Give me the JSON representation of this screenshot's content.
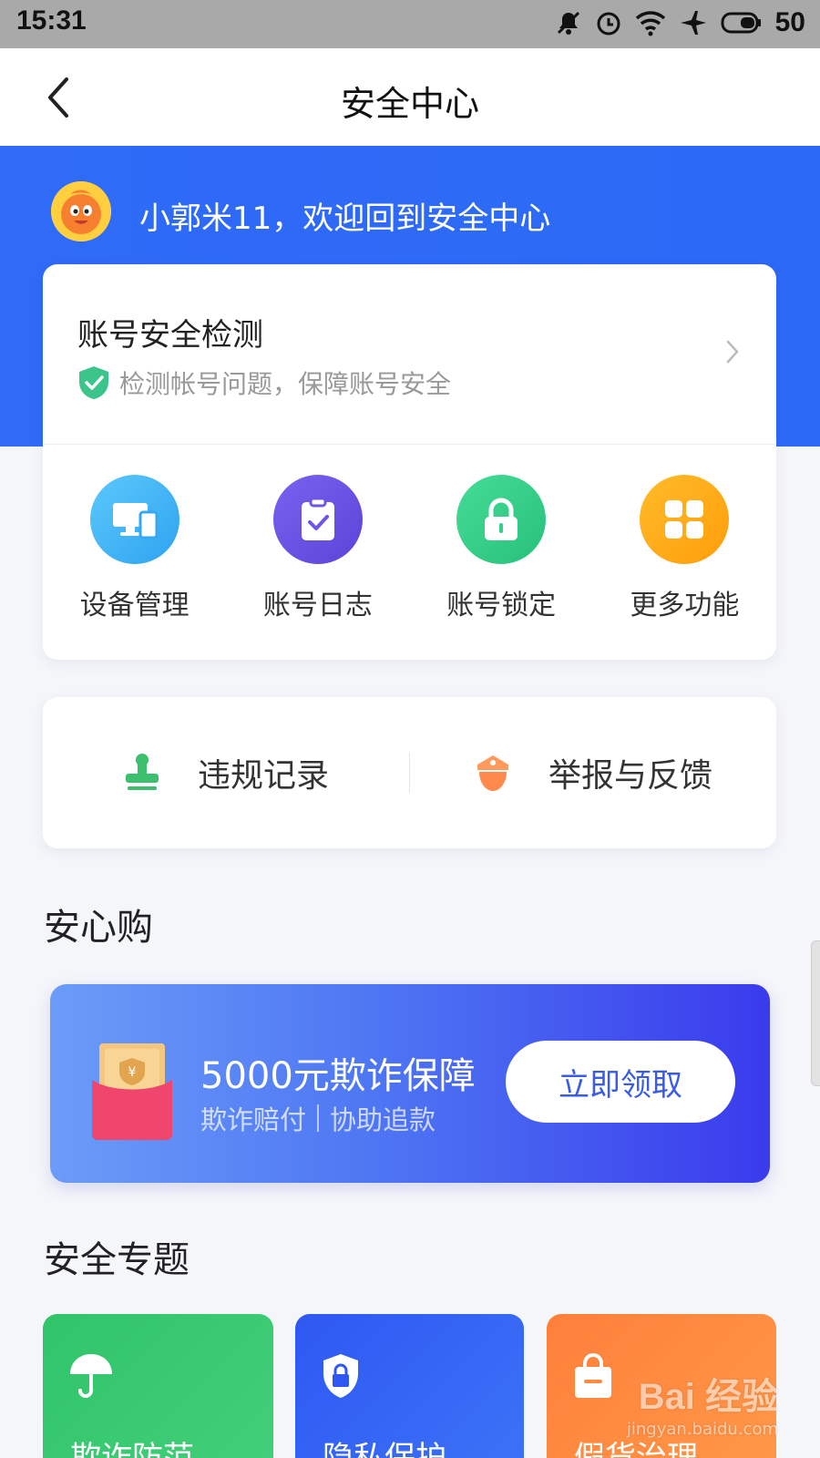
{
  "status_bar": {
    "time": "15:31",
    "battery_level": "50",
    "icons": [
      "mute-icon",
      "alarm-icon",
      "wifi-icon",
      "airplane-icon",
      "battery-icon"
    ]
  },
  "nav": {
    "title": "安全中心",
    "back_icon": "back-arrow-icon"
  },
  "hero": {
    "welcome": "小郭米11，欢迎回到安全中心",
    "background_color": "#2f6bf7"
  },
  "account_check": {
    "title": "账号安全检测",
    "subtitle": "检测帐号问题，保障账号安全",
    "shield_color": "#3cc58a"
  },
  "features": [
    {
      "label": "设备管理",
      "icon": "device-icon",
      "color": "#3fb7f5"
    },
    {
      "label": "账号日志",
      "icon": "clipboard-icon",
      "color": "#6a56e8"
    },
    {
      "label": "账号锁定",
      "icon": "lock-icon",
      "color": "#35d08a"
    },
    {
      "label": "更多功能",
      "icon": "grid-icon",
      "color": "#ffab19"
    }
  ],
  "records": [
    {
      "label": "违规记录",
      "icon": "stamp-icon",
      "color": "#3cc070"
    },
    {
      "label": "举报与反馈",
      "icon": "police-cap-icon",
      "color": "#ff8a4c"
    }
  ],
  "shop_section": {
    "title": "安心购",
    "promo_title": "5000元欺诈保障",
    "promo_sub_1": "欺诈赔付",
    "promo_sub_2": "协助追款",
    "button_label": "立即领取"
  },
  "topics_section": {
    "title": "安全专题",
    "items": [
      {
        "label": "欺诈防范",
        "icon": "umbrella-icon",
        "color": "#31c46a"
      },
      {
        "label": "隐私保护",
        "icon": "shield-lock-icon",
        "color": "#2f58f2"
      },
      {
        "label": "假货治理",
        "icon": "shopping-bag-icon",
        "color": "#ff7f3a"
      }
    ]
  },
  "watermark": {
    "logo": "Bai 经验",
    "url": "jingyan.baidu.com"
  }
}
